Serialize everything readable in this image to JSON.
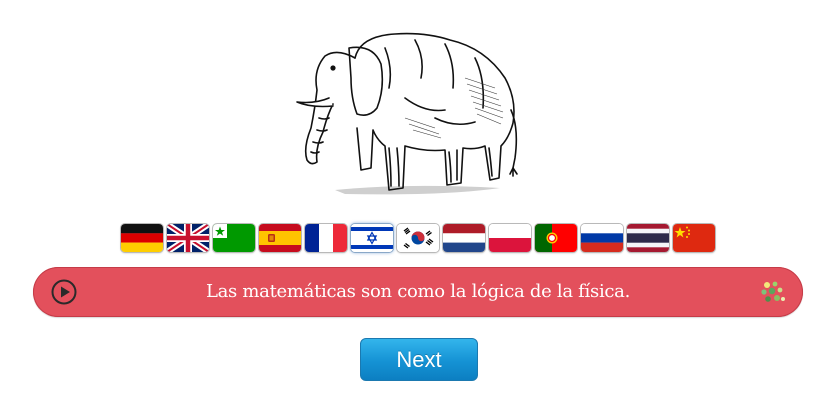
{
  "illustration": {
    "icon": "elephant-drawing"
  },
  "languages": [
    {
      "code": "de",
      "icon": "flag-germany"
    },
    {
      "code": "en",
      "icon": "flag-uk"
    },
    {
      "code": "eo",
      "icon": "flag-esperanto"
    },
    {
      "code": "es",
      "icon": "flag-spain"
    },
    {
      "code": "fr",
      "icon": "flag-france"
    },
    {
      "code": "he",
      "icon": "flag-israel"
    },
    {
      "code": "ko",
      "icon": "flag-korea"
    },
    {
      "code": "nl",
      "icon": "flag-netherlands"
    },
    {
      "code": "pl",
      "icon": "flag-poland"
    },
    {
      "code": "pt",
      "icon": "flag-portugal"
    },
    {
      "code": "ru",
      "icon": "flag-russia"
    },
    {
      "code": "th",
      "icon": "flag-thailand"
    },
    {
      "code": "zh",
      "icon": "flag-china"
    }
  ],
  "selected_language": "he",
  "sentence_bar": {
    "text": "Las matemáticas son como la lógica de la física.",
    "play_icon": "play-circle-icon",
    "menu_icon": "dots-icon",
    "background_color": "#e3505c"
  },
  "next_button": {
    "label": "Next",
    "color": "#1592d4"
  }
}
